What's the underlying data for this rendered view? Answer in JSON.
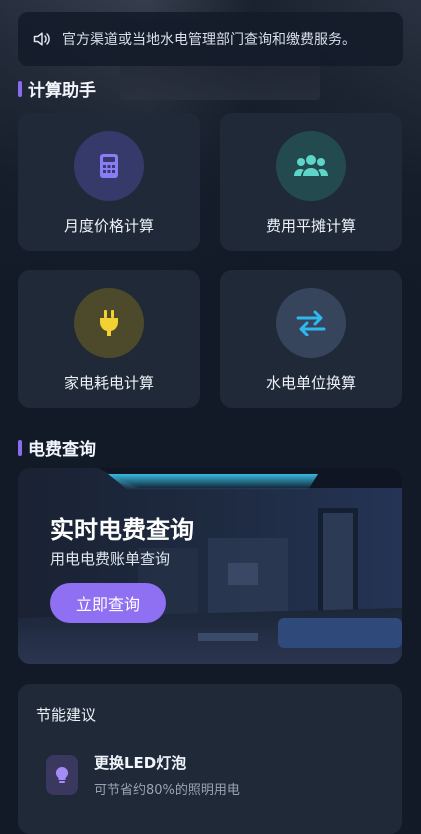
{
  "notice": {
    "icon": "speaker-icon",
    "text": "官方渠道或当地水电管理部门查询和缴费服务。"
  },
  "sections": {
    "calculator_title": "计算助手",
    "bill_title": "电费查询"
  },
  "calculators": [
    {
      "label": "月度价格计算",
      "icon": "calculator-icon",
      "circle_color": "#353a6b",
      "icon_color": "#8a7cf5"
    },
    {
      "label": "费用平摊计算",
      "icon": "users-icon",
      "circle_color": "#234a4e",
      "icon_color": "#5fd4c8"
    },
    {
      "label": "家电耗电计算",
      "icon": "plug-icon",
      "circle_color": "#4d4a2c",
      "icon_color": "#f2d233"
    },
    {
      "label": "水电单位换算",
      "icon": "exchange-icon",
      "circle_color": "#36455c",
      "icon_color": "#2fb7ee"
    }
  ],
  "banner": {
    "title": "实时电费查询",
    "subtitle": "用电电费账单查询",
    "button": "立即查询",
    "button_color": "#8f6ff2"
  },
  "tips": {
    "title": "节能建议",
    "items": [
      {
        "icon": "lightbulb-icon",
        "title": "更换LED灯泡",
        "desc": "可节省约80%的照明用电"
      }
    ]
  },
  "colors": {
    "accent": "#8b6cf0",
    "background": "#121a27",
    "card": "#1f2937"
  }
}
